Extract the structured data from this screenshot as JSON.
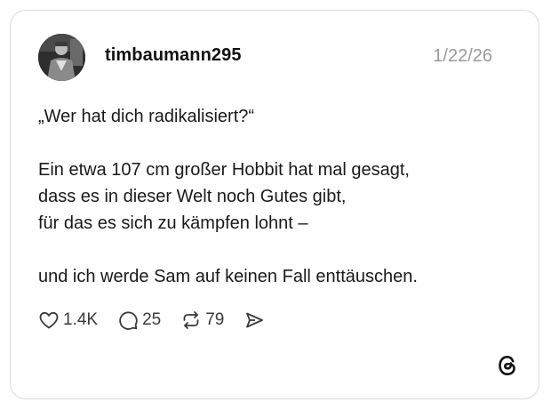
{
  "post": {
    "username": "timbaumann295",
    "date": "1/22/26",
    "lines": [
      "„Wer hat dich radikalisiert?“",
      "Ein etwa 107 cm großer Hobbit hat mal gesagt,",
      "dass es in dieser Welt noch Gutes gibt,",
      "für das es sich zu kämpfen lohnt –",
      "und ich werde Sam auf keinen Fall enttäuschen."
    ]
  },
  "actions": {
    "likes": "1.4K",
    "replies": "25",
    "reposts": "79"
  },
  "icons": {
    "like": "heart-icon",
    "reply": "speech-bubble-icon",
    "repost": "repost-icon",
    "share": "send-icon",
    "brand": "threads-logo-icon"
  }
}
